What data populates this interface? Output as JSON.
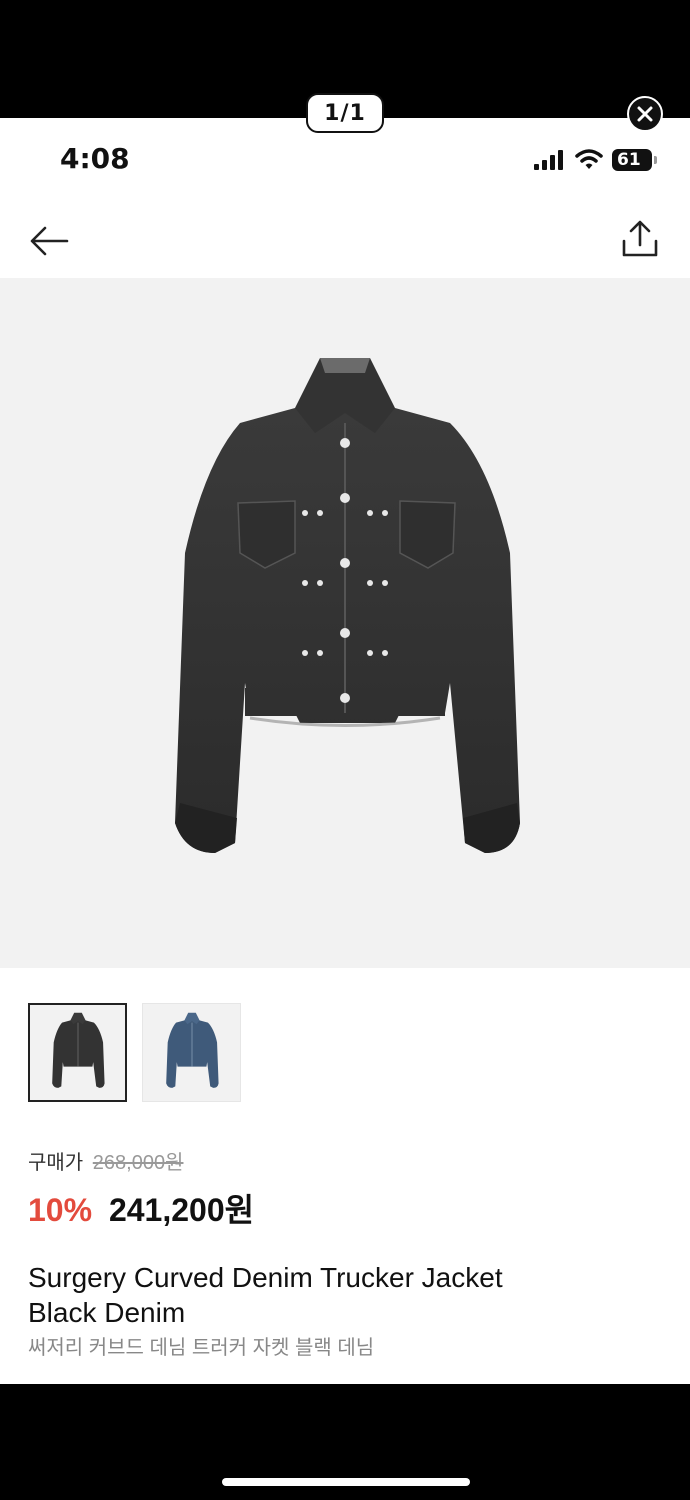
{
  "viewer": {
    "page_counter": "1/1",
    "close_icon": "close-icon"
  },
  "status_bar": {
    "time": "4:08",
    "battery": "61"
  },
  "nav": {
    "back_icon": "arrow-left-icon",
    "share_icon": "share-icon"
  },
  "product": {
    "main_image": "black-denim-jacket",
    "thumbnails": [
      {
        "image": "black-denim-jacket",
        "selected": true
      },
      {
        "image": "blue-denim-jacket",
        "selected": false
      }
    ],
    "price_label": "구매가",
    "original_price": "268,000원",
    "discount": "10%",
    "sale_price": "241,200원",
    "title_line1": "Surgery Curved Denim Trucker Jacket",
    "title_line2": "Black Denim",
    "title_ko": "써저리 커브드 데님 트러커 자켓 블랙 데님"
  },
  "colors": {
    "discount": "#e34b3d",
    "hero_bg": "#f2f2f2",
    "black_denim": "#3a3a3a",
    "blue_denim": "#3f5a7a"
  }
}
